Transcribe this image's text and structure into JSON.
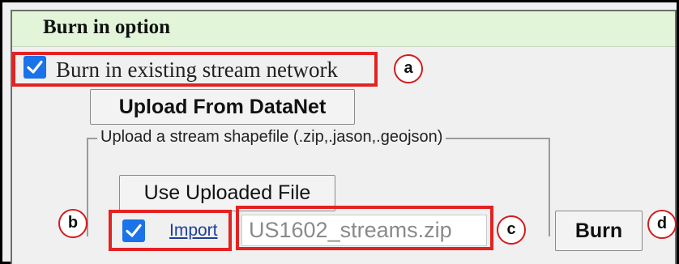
{
  "panel": {
    "title": "Burn in option"
  },
  "burn_existing": {
    "checked": true,
    "label": "Burn in existing stream network"
  },
  "upload_datanet_button": "Upload From DataNet",
  "shapefile_group": {
    "legend": "Upload a stream shapefile (.zip,.jason,.geojson)",
    "use_uploaded_button": "Use Uploaded File",
    "import_checked": true,
    "import_link": "Import",
    "file_value": "US1602_streams.zip"
  },
  "burn_button": "Burn",
  "callouts": [
    "a",
    "b",
    "c",
    "d"
  ],
  "colors": {
    "highlight_red": "#e32222",
    "checkbox_blue": "#1a73e8",
    "header_green": "#e2f5d8"
  }
}
